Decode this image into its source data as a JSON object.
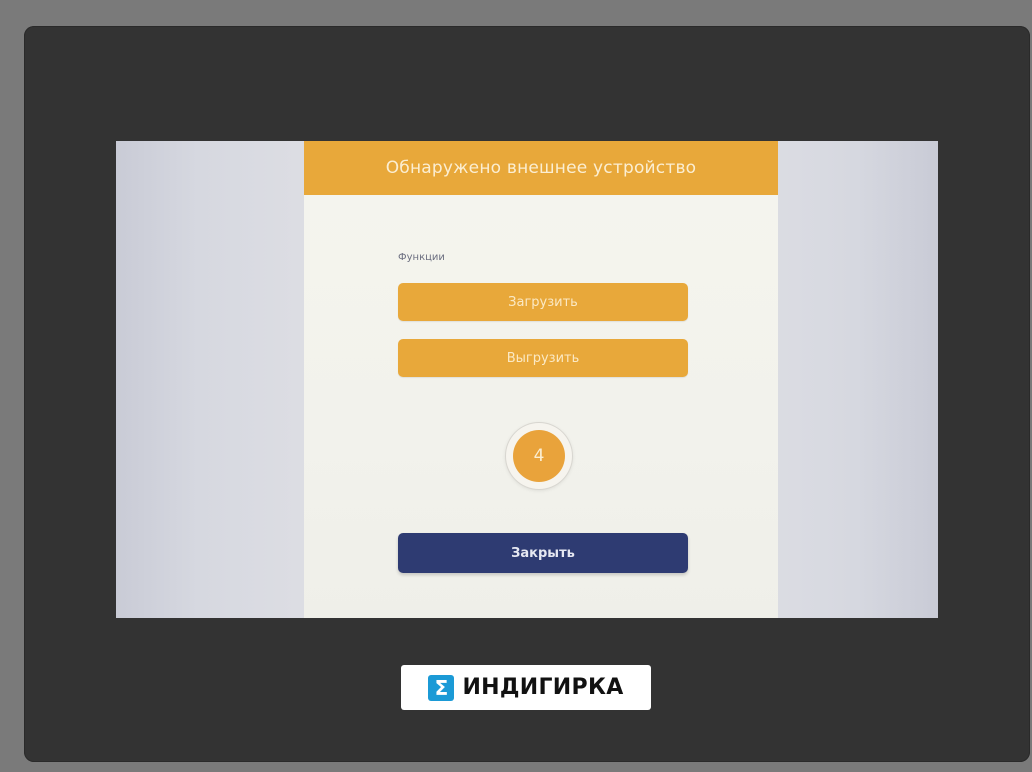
{
  "dialog": {
    "title": "Обнаружено внешнее устройство",
    "section_label": "Функции",
    "upload_label": "Загрузить",
    "download_label": "Выгрузить",
    "countdown": "4",
    "close_label": "Закрыть"
  },
  "branding": {
    "logo_mark": "Σ",
    "logo_text": "ИНДИГИРКА"
  },
  "colors": {
    "accent": "#e8a83a",
    "primary": "#2e3b72",
    "bezel": "#333333",
    "logo_blue": "#1b9ad6"
  },
  "icons": {
    "logo": "indigirka-logo-icon"
  }
}
